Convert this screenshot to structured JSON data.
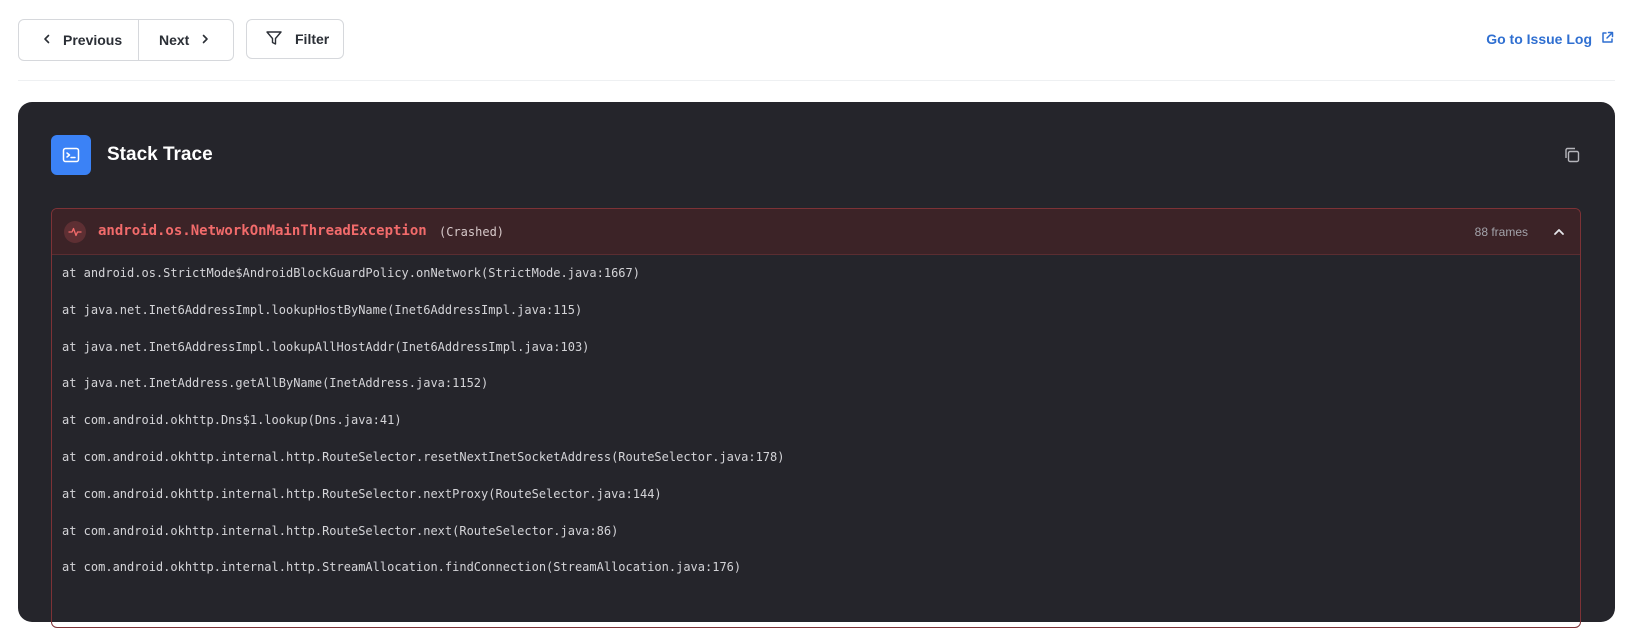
{
  "toolbar": {
    "previous_label": "Previous",
    "next_label": "Next",
    "filter_label": "Filter",
    "issue_log_label": "Go to Issue Log"
  },
  "panel": {
    "title": "Stack Trace"
  },
  "exception": {
    "name": "android.os.NetworkOnMainThreadException",
    "status": "(Crashed)",
    "frames_count": "88 frames",
    "frames": [
      "at android.os.StrictMode$AndroidBlockGuardPolicy.onNetwork(StrictMode.java:1667)",
      "at java.net.Inet6AddressImpl.lookupHostByName(Inet6AddressImpl.java:115)",
      "at java.net.Inet6AddressImpl.lookupAllHostAddr(Inet6AddressImpl.java:103)",
      "at java.net.InetAddress.getAllByName(InetAddress.java:1152)",
      "at com.android.okhttp.Dns$1.lookup(Dns.java:41)",
      "at com.android.okhttp.internal.http.RouteSelector.resetNextInetSocketAddress(RouteSelector.java:178)",
      "at com.android.okhttp.internal.http.RouteSelector.nextProxy(RouteSelector.java:144)",
      "at com.android.okhttp.internal.http.RouteSelector.next(RouteSelector.java:86)",
      "at com.android.okhttp.internal.http.StreamAllocation.findConnection(StreamAllocation.java:176)"
    ]
  },
  "colors": {
    "accent": "#2f6fd1",
    "panel_bg": "#25252b",
    "badge_bg": "#3b82f6",
    "error_text": "#f26b6b",
    "error_border": "#7d3236",
    "error_header_bg": "#3c2327"
  },
  "icons": {
    "previous": "chevron-left-icon",
    "next": "chevron-right-icon",
    "filter": "funnel-icon",
    "external": "external-link-icon",
    "terminal": "terminal-icon",
    "copy": "copy-icon",
    "activity": "pulse-icon",
    "collapse": "chevron-up-icon"
  }
}
